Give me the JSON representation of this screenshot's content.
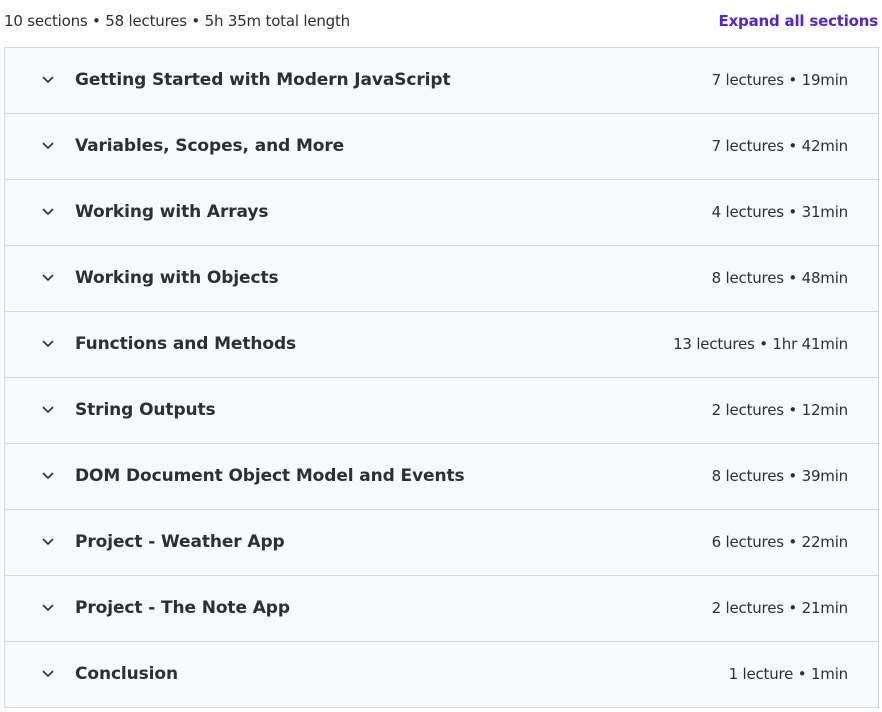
{
  "header": {
    "summary": "10 sections • 58 lectures • 5h 35m total length",
    "expand_all_label": "Expand all sections"
  },
  "sections": [
    {
      "title": "Getting Started with Modern JavaScript",
      "meta": "7 lectures • 19min"
    },
    {
      "title": "Variables, Scopes, and More",
      "meta": "7 lectures • 42min"
    },
    {
      "title": "Working with Arrays",
      "meta": "4 lectures • 31min"
    },
    {
      "title": "Working with Objects",
      "meta": "8 lectures • 48min"
    },
    {
      "title": "Functions and Methods",
      "meta": "13 lectures • 1hr 41min"
    },
    {
      "title": "String Outputs",
      "meta": "2 lectures • 12min"
    },
    {
      "title": "DOM Document Object Model and Events",
      "meta": "8 lectures • 39min"
    },
    {
      "title": "Project - Weather App",
      "meta": "6 lectures • 22min"
    },
    {
      "title": "Project - The Note App",
      "meta": "2 lectures • 21min"
    },
    {
      "title": "Conclusion",
      "meta": "1 lecture • 1min"
    }
  ],
  "icons": {
    "section_toggle": "chevron-down-icon"
  },
  "colors": {
    "accent": "#5624d0",
    "text": "#2d2f31",
    "section_bg": "#f7f9fa",
    "border": "#d1d7dc"
  }
}
